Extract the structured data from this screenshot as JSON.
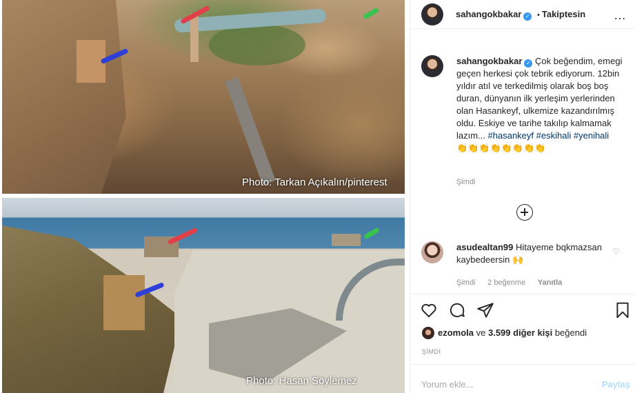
{
  "photos": {
    "top_credit": "Photo: Tarkan Açıkalın/pinterest",
    "bottom_credit": "Photo: Hasan Söylemez"
  },
  "header": {
    "username": "sahangokbakar",
    "separator": "•",
    "follow_status": "Takiptesin",
    "more_icon": "…"
  },
  "caption": {
    "username": "sahangokbakar",
    "text": "Çok beğendim, emegi geçen herkesi çok tebrik ediyorum. 12bin yıldır atıl ve terkedilmiş olarak boş boş duran, dünyanın ilk yerleşim yerlerinden olan Hasankeyf, ulkemize kazandırılmış oldu. Eskiye ve tarihe takılıp kalmamak lazım...",
    "hashtags": [
      "#hasankeyf",
      "#eskihali",
      "#yenihali"
    ],
    "emoji": "👏👏👏👏👏👏👏👏",
    "time": "Şimdi"
  },
  "comment": {
    "username": "asudealtan99",
    "text": "Hitayeme bqkmazsan kaybedeersin 🙌",
    "time": "Şimdi",
    "likes": "2 beğenme",
    "reply": "Yanıtla"
  },
  "likes": {
    "user": "ezomola",
    "middle": " ve ",
    "others": "3.599 diğer kişi",
    "suffix": " beğendi"
  },
  "post_date": "ŞİMDİ",
  "comment_box": {
    "placeholder": "Yorum ekle...",
    "post_label": "Paylaş"
  },
  "icons": {
    "heart": "heart-icon",
    "comment": "comment-icon",
    "share": "share-icon",
    "save": "bookmark-icon",
    "add_comments": "plus-circle-icon"
  },
  "colors": {
    "verified": "#3897f0",
    "hashtag": "#00376b",
    "muted": "#8e8e8e",
    "post_button": "#b2dffc"
  }
}
